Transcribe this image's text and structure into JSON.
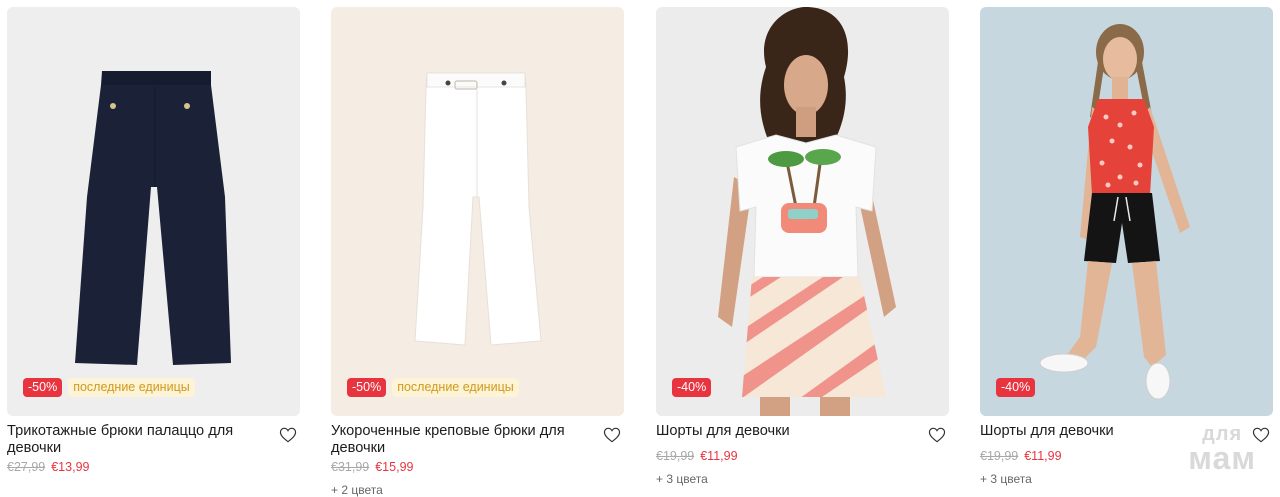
{
  "products": [
    {
      "title": "Трикотажные брюки палаццо для девочки",
      "old_price": "€27,99",
      "new_price": "€13,99",
      "discount": "-50%",
      "tag": "последние единицы",
      "colors": ""
    },
    {
      "title": "Укороченные креповые брюки для девочки",
      "old_price": "€31,99",
      "new_price": "€15,99",
      "discount": "-50%",
      "tag": "последние единицы",
      "colors": "+ 2 цвета"
    },
    {
      "title": "Шорты для девочки",
      "old_price": "€19,99",
      "new_price": "€11,99",
      "discount": "-40%",
      "tag": "",
      "colors": "+ 3 цвета"
    },
    {
      "title": "Шорты для девочки",
      "old_price": "€19,99",
      "new_price": "€11,99",
      "discount": "-40%",
      "tag": "",
      "colors": "+ 3 цвета"
    }
  ],
  "watermark": {
    "line1": "для",
    "line2": "мам"
  },
  "icons": {
    "favorite": "heart-outline-icon"
  },
  "colors": {
    "sale": "#e8343f",
    "tag_bg": "#fdf3d6",
    "tag_text": "#d19a1b",
    "old_price": "#a8a8a8",
    "photo_bg_1": "#efefef",
    "photo_bg_2": "#f5ece3",
    "photo_bg_3": "#ececec",
    "photo_bg_4": "#c6d7df"
  }
}
